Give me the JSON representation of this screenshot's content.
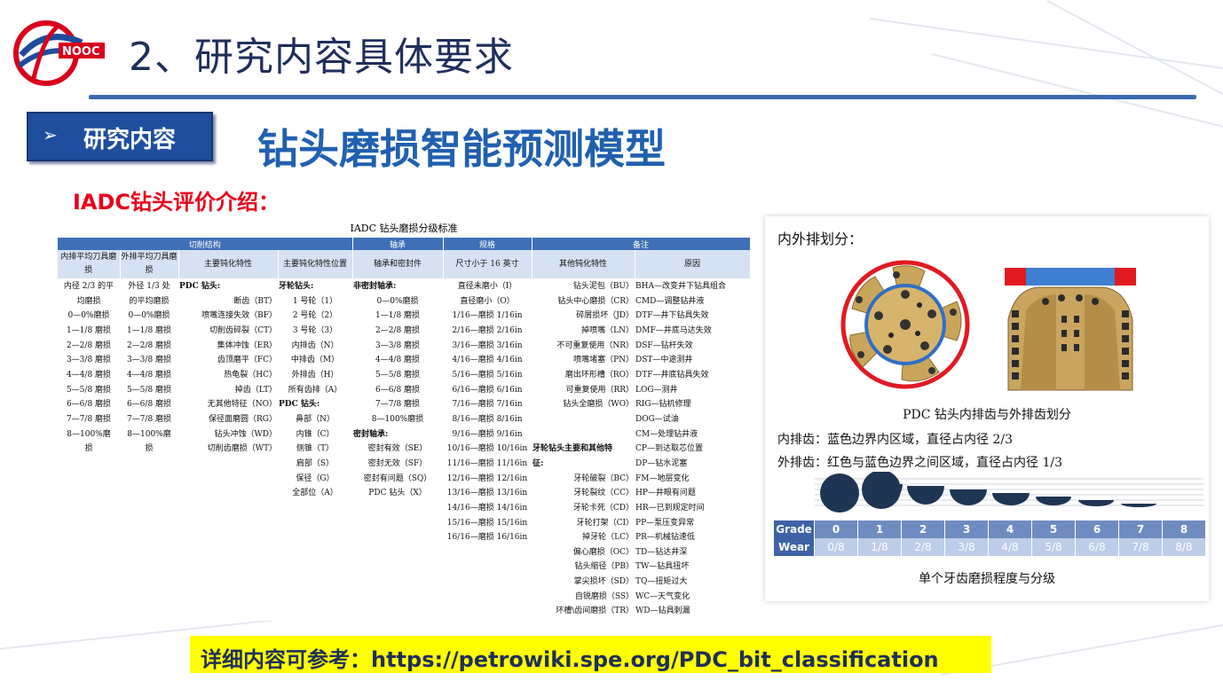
{
  "header": {
    "title": "2、研究内容具体要求"
  },
  "section": {
    "arrow": "➢",
    "label": "研究内容"
  },
  "subtitle": "钻头磨损智能预测模型",
  "iadc_label": "IADC钻头评价介绍：",
  "table": {
    "title": "IADC 钻头磨损分级标准",
    "groups": [
      "切削结构",
      "轴承",
      "规格",
      "备注"
    ],
    "headers": {
      "c1": "内排平均刀具磨损",
      "c2": "外排平均刀具磨损",
      "c3": "主要钝化特性",
      "c4": "主要钝化特性位置",
      "c5": "轴承和密封件",
      "c6": "尺寸小于 16 英寸",
      "c7": "其他钝化特性",
      "c8": "原因"
    },
    "columns": {
      "c1": [
        "内径 2/3 的平",
        "均磨损",
        "0—0%磨损",
        "1—1/8 磨损",
        "2—2/8 磨损",
        "3—3/8 磨损",
        "4—4/8 磨损",
        "5—5/8 磨损",
        "6—6/8 磨损",
        "7—7/8 磨损",
        "8—100%磨",
        "损"
      ],
      "c2": [
        "外径 1/3 处",
        "的平均磨损",
        "0—0%磨损",
        "1—1/8 磨损",
        "2—2/8 磨损",
        "3—3/8 磨损",
        "4—4/8 磨损",
        "5—5/8 磨损",
        "6—6/8 磨损",
        "7—7/8 磨损",
        "8—100%磨",
        "损"
      ],
      "c3": [
        {
          "t": "PDC 钻头:",
          "bold": true,
          "align": "al"
        },
        {
          "t": "断齿（BT）"
        },
        {
          "t": "喷嘴连接失效（BF）"
        },
        {
          "t": "切削齿碎裂（CT）"
        },
        {
          "t": "集体冲蚀（ER）"
        },
        {
          "t": "齿顶磨平（FC）"
        },
        {
          "t": "热龟裂（HC）"
        },
        {
          "t": "掉齿（LT）"
        },
        {
          "t": "无其他特征（NO）"
        },
        {
          "t": "保径面磨圆（RG）"
        },
        {
          "t": "钻头冲蚀（WD）"
        },
        {
          "t": "切削齿磨损（WT）"
        }
      ],
      "c4": [
        {
          "t": "牙轮钻头:",
          "bold": true,
          "align": "al"
        },
        {
          "t": "1 号轮（1）"
        },
        {
          "t": "2 号轮（2）"
        },
        {
          "t": "3 号轮（3）"
        },
        {
          "t": "内排齿（N）"
        },
        {
          "t": "中排齿（M）"
        },
        {
          "t": "外排齿（H）"
        },
        {
          "t": "所有齿排（A）"
        },
        {
          "t": "PDC 钻头:",
          "bold": true,
          "align": "al"
        },
        {
          "t": "鼻部（N）"
        },
        {
          "t": "内锥（C）"
        },
        {
          "t": "侧锥（T）"
        },
        {
          "t": "肩部（S）"
        },
        {
          "t": "保径（G）"
        },
        {
          "t": "全部位（A）"
        }
      ],
      "c5": [
        {
          "t": "非密封轴承:",
          "bold": true,
          "align": "al"
        },
        {
          "t": "0—0%磨损"
        },
        {
          "t": "1—1/8 磨损"
        },
        {
          "t": "2—2/8 磨损"
        },
        {
          "t": "3—3/8 磨损"
        },
        {
          "t": "4—4/8 磨损"
        },
        {
          "t": "5—5/8 磨损"
        },
        {
          "t": "6—6/8 磨损"
        },
        {
          "t": "7—7/8 磨损"
        },
        {
          "t": "8—100%磨损"
        },
        {
          "t": "密封轴承:",
          "bold": true,
          "align": "al"
        },
        {
          "t": "密封有效（SE）"
        },
        {
          "t": "密封无效（SF）"
        },
        {
          "t": "密封有问题（SQ）"
        },
        {
          "t": "PDC 钻头（X）"
        }
      ],
      "c6": [
        "直径未磨小（I）",
        "直径磨小（O）",
        "1/16—磨损 1/16in",
        "2/16—磨损 2/16in",
        "3/16—磨损 3/16in",
        "4/16—磨损 4/16in",
        "5/16—磨损 5/16in",
        "6/16—磨损 6/16in",
        "7/16—磨损 7/16in",
        "8/16—磨损 8/16in",
        "9/16—磨损 9/16in",
        "10/16—磨损 10/16in",
        "11/16—磨损 11/16in",
        "12/16—磨损 12/16in",
        "13/16—磨损 13/16in",
        "14/16—磨损 14/16in",
        "15/16—磨损 15/16in",
        "16/16—磨损 16/16in"
      ],
      "c7": [
        {
          "t": "钻头泥包（BU）"
        },
        {
          "t": "钻头中心磨损（CR）"
        },
        {
          "t": "碎屑损坏（JD）"
        },
        {
          "t": "掉喷嘴（LN）"
        },
        {
          "t": "不可重复使用（NR）"
        },
        {
          "t": "喷嘴堵塞（PN）"
        },
        {
          "t": "磨出环形槽（RO）"
        },
        {
          "t": "可重复使用（RR）"
        },
        {
          "t": "钻头全磨损（WO）"
        },
        {
          "t": ""
        },
        {
          "t": ""
        },
        {
          "t": "牙轮钻头主要和其他特",
          "bold": true,
          "align": "al"
        },
        {
          "t": "征:",
          "bold": true,
          "align": "al"
        },
        {
          "t": "牙轮破裂（BC）"
        },
        {
          "t": "牙轮裂纹（CC）"
        },
        {
          "t": "牙轮卡死（CD）"
        },
        {
          "t": "牙轮打架（CI）"
        },
        {
          "t": "掉牙轮（LC）"
        },
        {
          "t": "偏心磨损（OC）"
        },
        {
          "t": "钻头缩径（PB）"
        },
        {
          "t": "掌尖损坏（SD）"
        },
        {
          "t": "自锐磨损（SS）"
        },
        {
          "t": "环槽\\齿间磨损（TR）"
        }
      ],
      "c8": [
        "BHA—改变井下钻具组合",
        "CMD—调整钻井液",
        "DTF—井下钻具失效",
        "DMF—井底马达失效",
        "DSF—钻杆失效",
        "DST—中途测井",
        "DTF—井底钻具失效",
        "LOG—测井",
        "RIG—钻机修理",
        "DOG—试油",
        "CM—处理钻井液",
        "CP—到达取芯位置",
        "DP—钻水泥塞",
        "FM—地层变化",
        "HP—井眼有问题",
        "HR—已到规定时间",
        "PP—泵压变异常",
        "PR—机械钻速低",
        "TD—钻达井深",
        "TW—钻具扭坏",
        "TQ—扭矩过大",
        "WC—天气变化",
        "WD—钻具刺漏"
      ]
    }
  },
  "right_panel": {
    "title": "内外排划分：",
    "caption": "PDC 钻头内排齿与外排齿划分",
    "inner": "内排齿：蓝色边界内区域，直径占内径 2/3",
    "outer": "外排齿：红色与蓝色边界之间区域，直径占内径 1/3",
    "grade_label": "Grade",
    "grades": [
      "0",
      "1",
      "2",
      "3",
      "4",
      "5",
      "6",
      "7",
      "8"
    ],
    "wear_label": "Wear",
    "wear": [
      "0/8",
      "1/8",
      "2/8",
      "3/8",
      "4/8",
      "5/8",
      "6/8",
      "7/8",
      "8/8"
    ],
    "caption2": "单个牙齿磨损程度与分级"
  },
  "footer": {
    "ref": "详细内容可参考：https://petrowiki.spe.org/PDC_bit_classification"
  },
  "colors": {
    "navy": "#1f2f5c",
    "blue": "#2060b0",
    "red": "#e8001a",
    "table_header": "#3f6fb7",
    "highlight": "#ffff00"
  }
}
